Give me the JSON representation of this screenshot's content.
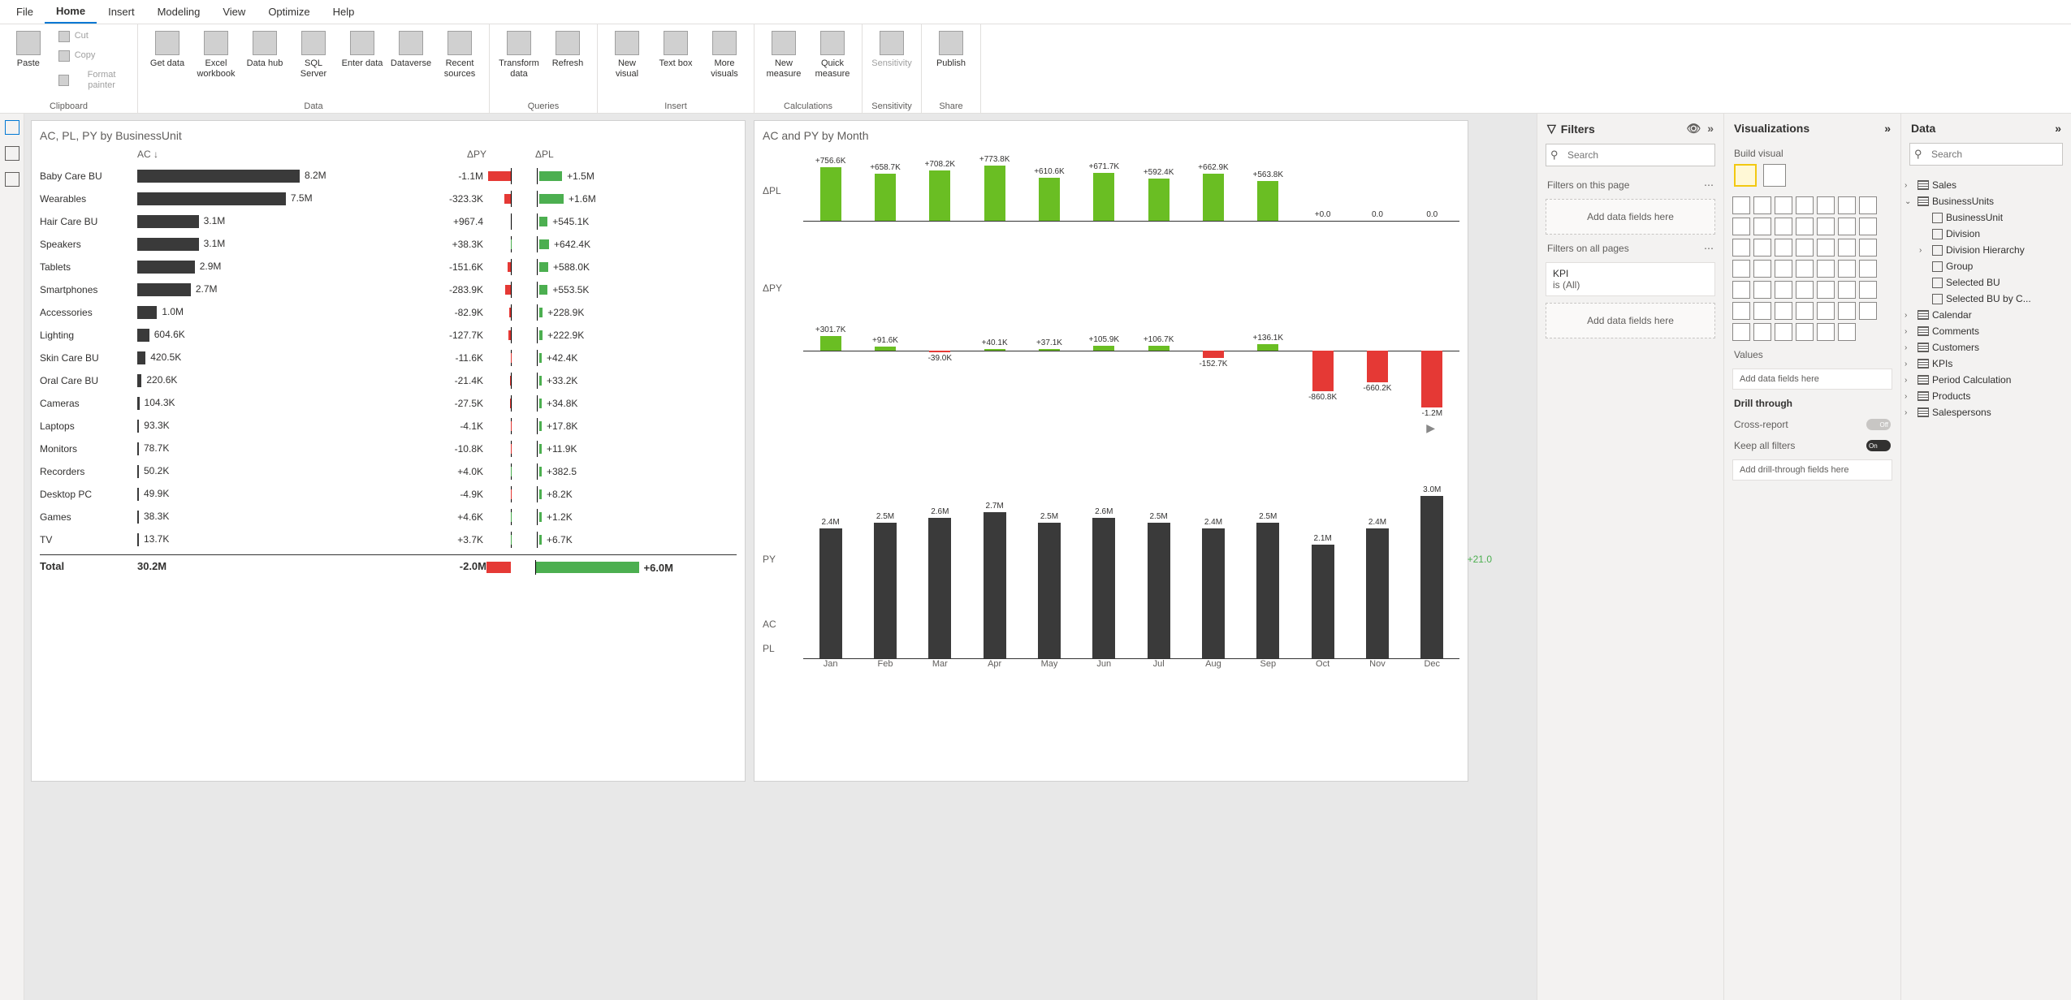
{
  "menubar": [
    "File",
    "Home",
    "Insert",
    "Modeling",
    "View",
    "Optimize",
    "Help"
  ],
  "ribbon": {
    "clipboard": {
      "paste": "Paste",
      "cut": "Cut",
      "copy": "Copy",
      "format": "Format painter",
      "label": "Clipboard"
    },
    "data": {
      "get": "Get data",
      "excel": "Excel workbook",
      "hub": "Data hub",
      "sql": "SQL Server",
      "enter": "Enter data",
      "dataverse": "Dataverse",
      "recent": "Recent sources",
      "label": "Data"
    },
    "queries": {
      "transform": "Transform data",
      "refresh": "Refresh",
      "label": "Queries"
    },
    "insert": {
      "newvis": "New visual",
      "textbox": "Text box",
      "more": "More visuals",
      "label": "Insert"
    },
    "calc": {
      "newmeasure": "New measure",
      "quick": "Quick measure",
      "label": "Calculations"
    },
    "sens": {
      "sens": "Sensitivity",
      "label": "Sensitivity"
    },
    "share": {
      "publish": "Publish",
      "label": "Share"
    }
  },
  "chart1": {
    "title": "AC, PL, PY by BusinessUnit",
    "h_ac": "AC ↓",
    "h_dpy": "ΔPY",
    "h_dpl": "ΔPL",
    "total_lbl": "Total",
    "total_ac": "30.2M",
    "total_dpy": "-2.0M",
    "total_dpl": "+6.0M"
  },
  "chart2": {
    "title": "AC and PY by Month",
    "dpl": "ΔPL",
    "dpy": "ΔPY",
    "py": "PY",
    "ac": "AC",
    "pl": "PL",
    "ytd": "+21.0"
  },
  "filters": {
    "title": "Filters",
    "search": "Search",
    "onpage": "Filters on this page",
    "add": "Add data fields here",
    "allpages": "Filters on all pages",
    "kpi": "KPI",
    "kpival": "is (All)"
  },
  "viz": {
    "title": "Visualizations",
    "build": "Build visual",
    "values": "Values",
    "addv": "Add data fields here",
    "drill": "Drill through",
    "cross": "Cross-report",
    "off": "Off",
    "keep": "Keep all filters",
    "on": "On",
    "adddrill": "Add drill-through fields here"
  },
  "data": {
    "title": "Data",
    "search": "Search",
    "tables": [
      "Sales",
      "BusinessUnits",
      "Calendar",
      "Comments",
      "Customers",
      "KPIs",
      "Period Calculation",
      "Products",
      "Salespersons"
    ],
    "bu_fields": [
      "BusinessUnit",
      "Division",
      "Division Hierarchy",
      "Group",
      "Selected BU",
      "Selected BU by C..."
    ]
  },
  "chart_data": [
    {
      "type": "bar",
      "title": "AC, PL, PY by BusinessUnit",
      "categories": [
        "Baby Care BU",
        "Wearables",
        "Hair Care BU",
        "Speakers",
        "Tablets",
        "Smartphones",
        "Accessories",
        "Lighting",
        "Skin Care BU",
        "Oral Care BU",
        "Cameras",
        "Laptops",
        "Monitors",
        "Recorders",
        "Desktop PC",
        "Games",
        "TV"
      ],
      "series": [
        {
          "name": "AC",
          "values": [
            "8.2M",
            "7.5M",
            "3.1M",
            "3.1M",
            "2.9M",
            "2.7M",
            "1.0M",
            "604.6K",
            "420.5K",
            "220.6K",
            "104.3K",
            "93.3K",
            "78.7K",
            "50.2K",
            "49.9K",
            "38.3K",
            "13.7K"
          ],
          "numeric": [
            8200,
            7500,
            3100,
            3100,
            2900,
            2700,
            1000,
            604.6,
            420.5,
            220.6,
            104.3,
            93.3,
            78.7,
            50.2,
            49.9,
            38.3,
            13.7
          ]
        },
        {
          "name": "ΔPY",
          "values": [
            "-1.1M",
            "-323.3K",
            "+967.4",
            "+38.3K",
            "-151.6K",
            "-283.9K",
            "-82.9K",
            "-127.7K",
            "-11.6K",
            "-21.4K",
            "-27.5K",
            "-4.1K",
            "-10.8K",
            "+4.0K",
            "-4.9K",
            "+4.6K",
            "+3.7K"
          ],
          "numeric": [
            -1100,
            -323.3,
            0.967,
            38.3,
            -151.6,
            -283.9,
            -82.9,
            -127.7,
            -11.6,
            -21.4,
            -27.5,
            -4.1,
            -10.8,
            4.0,
            -4.9,
            4.6,
            3.7
          ]
        },
        {
          "name": "ΔPL",
          "values": [
            "+1.5M",
            "+1.6M",
            "+545.1K",
            "+642.4K",
            "+588.0K",
            "+553.5K",
            "+228.9K",
            "+222.9K",
            "+42.4K",
            "+33.2K",
            "+34.8K",
            "+17.8K",
            "+11.9K",
            "+382.5",
            "+8.2K",
            "+1.2K",
            "+6.7K"
          ],
          "numeric": [
            1500,
            1600,
            545.1,
            642.4,
            588.0,
            553.5,
            228.9,
            222.9,
            42.4,
            33.2,
            34.8,
            0.382,
            8.2,
            1.2,
            6.7
          ]
        }
      ],
      "total": {
        "AC": "30.2M",
        "ΔPY": "-2.0M",
        "ΔPL": "+6.0M"
      }
    },
    {
      "type": "bar",
      "title": "AC and PY by Month",
      "categories": [
        "Jan",
        "Feb",
        "Mar",
        "Apr",
        "May",
        "Jun",
        "Jul",
        "Aug",
        "Sep",
        "Oct",
        "Nov",
        "Dec"
      ],
      "series": [
        {
          "name": "ΔPL",
          "values": [
            "+756.6K",
            "+658.7K",
            "+708.2K",
            "+773.8K",
            "+610.6K",
            "+671.7K",
            "+592.4K",
            "+662.9K",
            "+563.8K",
            "+0.0",
            "0.0",
            "0.0"
          ],
          "numeric": [
            756.6,
            658.7,
            708.2,
            773.8,
            610.6,
            671.7,
            592.4,
            662.9,
            563.8,
            0,
            0,
            0
          ]
        },
        {
          "name": "ΔPY",
          "values": [
            "+301.7K",
            "+91.6K",
            "-39.0K",
            "+40.1K",
            "+37.1K",
            "+105.9K",
            "+106.7K",
            "-152.7K",
            "+136.1K",
            "-860.8K",
            "-660.2K",
            "-1.2M"
          ],
          "numeric": [
            301.7,
            91.6,
            -39.0,
            40.1,
            37.1,
            105.9,
            106.7,
            -152.7,
            136.1,
            -860.8,
            -660.2,
            -1200
          ]
        },
        {
          "name": "AC",
          "values": [
            "2.4M",
            "2.5M",
            "2.6M",
            "2.7M",
            "2.5M",
            "2.6M",
            "2.5M",
            "2.4M",
            "2.5M",
            "2.1M",
            "2.4M",
            "3.0M"
          ],
          "numeric": [
            2.4,
            2.5,
            2.6,
            2.7,
            2.5,
            2.6,
            2.5,
            2.4,
            2.5,
            2.1,
            2.4,
            3.0
          ]
        }
      ]
    }
  ]
}
